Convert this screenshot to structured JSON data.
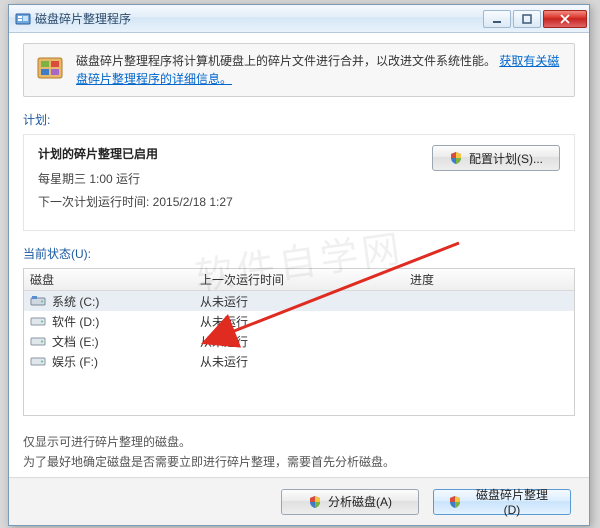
{
  "window": {
    "title": "磁盘碎片整理程序"
  },
  "info": {
    "message_prefix": "磁盘碎片整理程序将计算机硬盘上的碎片文件进行合并，以改进文件系统性能。",
    "link_text": "获取有关磁盘碎片整理程序的详细信息。"
  },
  "schedule": {
    "section_label": "计划:",
    "enabled_title": "计划的碎片整理已启用",
    "frequency_line": "每星期三  1:00 运行",
    "next_run_line": "下一次计划运行时间: 2015/2/18 1:27",
    "configure_btn": "配置计划(S)..."
  },
  "status": {
    "section_label": "当前状态(U):",
    "columns": {
      "disk": "磁盘",
      "last": "上一次运行时间",
      "progress": "进度"
    },
    "rows": [
      {
        "name": "系统 (C:)",
        "last": "从未运行",
        "type": "sys",
        "selected": true
      },
      {
        "name": "软件 (D:)",
        "last": "从未运行",
        "type": "hdd",
        "selected": false
      },
      {
        "name": "文档 (E:)",
        "last": "从未运行",
        "type": "hdd",
        "selected": false
      },
      {
        "name": "娱乐 (F:)",
        "last": "从未运行",
        "type": "hdd",
        "selected": false
      }
    ]
  },
  "note": {
    "line1": "仅显示可进行碎片整理的磁盘。",
    "line2": "为了最好地确定磁盘是否需要立即进行碎片整理，需要首先分析磁盘。"
  },
  "footer": {
    "analyze": "分析磁盘(A)",
    "defrag": "磁盘碎片整理(D)"
  },
  "watermark": "软件自学网"
}
